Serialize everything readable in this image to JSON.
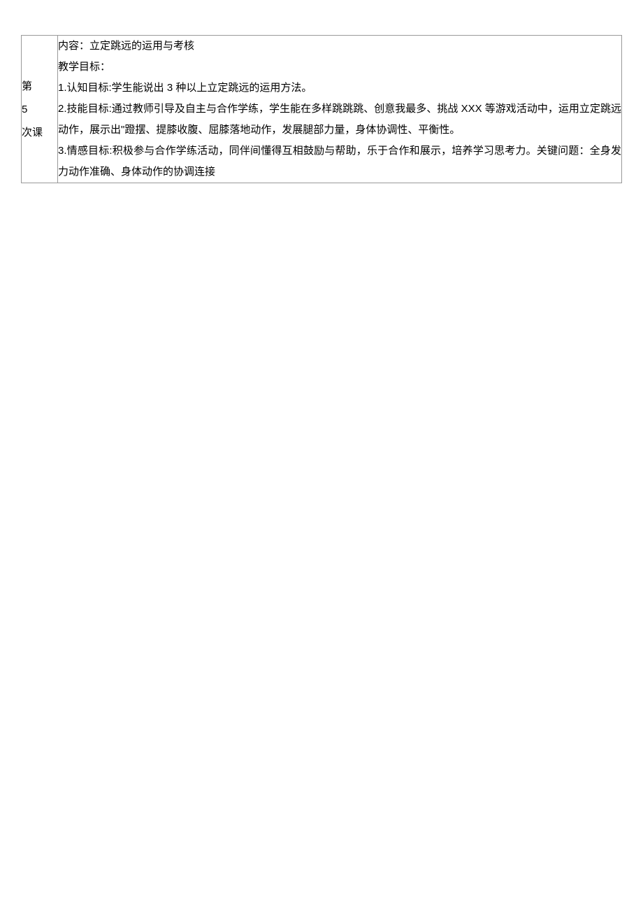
{
  "left": {
    "line1": "第",
    "line2": "5",
    "line3": "次课"
  },
  "right": {
    "line1": "内容：立定跳远的运用与考核",
    "line2": "教学目标：",
    "line3": "1.认知目标:学生能说出 3 种以上立定跳远的运用方法。",
    "line4": "2.技能目标:通过教师引导及自主与合作学练，学生能在多样跳跳跳、创意我最多、挑战 XXX 等游戏活动中，运用立定跳远动作，展示出\"蹬摆、提膝收腹、屈膝落地动作，发展腿部力量，身体协调性、平衡性。",
    "line5": "3.情感目标:积极参与合作学练活动，同伴间懂得互相鼓励与帮助，乐于合作和展示，培养学习思考力。关键问题：全身发力动作准确、身体动作的协调连接"
  }
}
